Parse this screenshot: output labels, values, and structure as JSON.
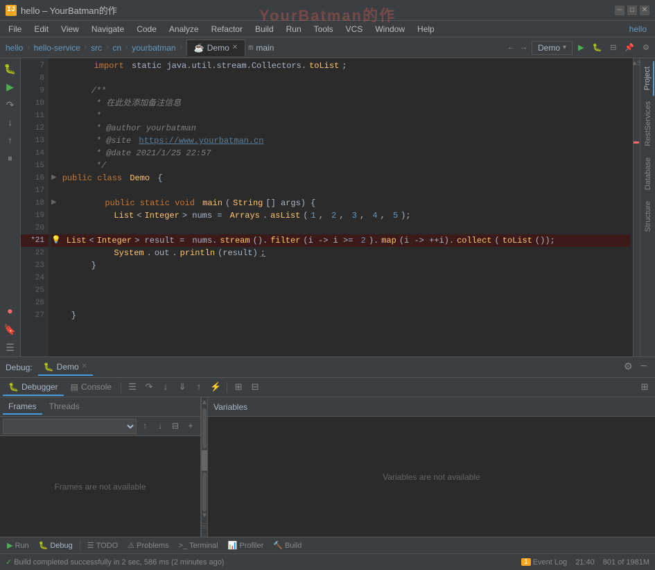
{
  "window": {
    "title": "hello – YourBatman的作",
    "watermark": "YourBatman的作"
  },
  "titlebar": {
    "app_icon": "IJ",
    "title": "hello – YourBatman的作",
    "min_label": "─",
    "max_label": "□",
    "close_label": "✕"
  },
  "menubar": {
    "items": [
      "File",
      "Edit",
      "View",
      "Navigate",
      "Code",
      "Analyze",
      "Refactor",
      "Build",
      "Run",
      "Tools",
      "VCS",
      "Window",
      "Help"
    ]
  },
  "tabbar": {
    "greeting": "hello",
    "breadcrumbs": [
      "hello-service",
      "src",
      "cn",
      "yourbatman"
    ],
    "file_icon": "☕",
    "file_name": "Demo",
    "method_icon": "m",
    "method_name": "main",
    "nav_back": "←",
    "nav_forward": "→",
    "run_config": "Demo",
    "run_config_dropdown": "▾",
    "btn_run": "▶",
    "btn_layout": "⊟",
    "btn_bookmark": "🔖",
    "btn_settings": "⚙"
  },
  "editor": {
    "lines": [
      {
        "num": 7,
        "indent": 1,
        "content": "import static java.util.stream.Collectors.",
        "highlight": "toList",
        "rest": ";"
      },
      {
        "num": 8,
        "indent": 0,
        "content": ""
      },
      {
        "num": 9,
        "indent": 1,
        "content": "/**"
      },
      {
        "num": 10,
        "indent": 1,
        "content": " * 在此处添加备注信息"
      },
      {
        "num": 11,
        "indent": 1,
        "content": " *"
      },
      {
        "num": 12,
        "indent": 1,
        "content": " * @author yourbatman"
      },
      {
        "num": 13,
        "indent": 1,
        "content": " * @site https://www.yourbatman.cn"
      },
      {
        "num": 14,
        "indent": 1,
        "content": " * @date 2021/1/25 22:57"
      },
      {
        "num": 15,
        "indent": 1,
        "content": " */"
      },
      {
        "num": 16,
        "indent": 1,
        "content": "public class Demo {",
        "fold": true
      },
      {
        "num": 17,
        "indent": 0,
        "content": ""
      },
      {
        "num": 18,
        "indent": 2,
        "content": "public static void main(String[] args) {",
        "fold": true
      },
      {
        "num": 19,
        "indent": 3,
        "content": "List<Integer> nums = Arrays.asList(1, 2, 3, 4, 5);"
      },
      {
        "num": 20,
        "indent": 0,
        "content": ""
      },
      {
        "num": 21,
        "indent": 3,
        "content": "List<Integer> result = nums.stream().filter(i -> i >= 2).map(i -> ++i).collect(toList());",
        "error": true,
        "warning": true
      },
      {
        "num": 22,
        "indent": 3,
        "content": "System.out.println(result);"
      },
      {
        "num": 23,
        "indent": 2,
        "content": "}"
      },
      {
        "num": 24,
        "indent": 0,
        "content": ""
      },
      {
        "num": 25,
        "indent": 0,
        "content": ""
      },
      {
        "num": 26,
        "indent": 0,
        "content": ""
      },
      {
        "num": 27,
        "indent": 1,
        "content": "}"
      }
    ],
    "error_count": "▲ 3"
  },
  "right_sidebar": {
    "tabs": [
      "Project",
      "RestServices",
      "Database",
      "Structure"
    ]
  },
  "debug_panel": {
    "debug_label": "Debug:",
    "session_name": "Demo",
    "close_session": "✕",
    "settings_icon": "⚙",
    "minimize_icon": "─",
    "tabs": {
      "debugger_label": "Debugger",
      "console_label": "Console"
    },
    "toolbar_buttons": [
      "☰",
      "↑",
      "↓",
      "↙",
      "↗",
      "⚡",
      "⊞",
      "⊟"
    ],
    "frames_tabs": [
      "Frames",
      "Threads"
    ],
    "dropdown_placeholder": "",
    "frames_empty_text": "Frames are not available",
    "variables_label": "Variables",
    "variables_empty_text": "Variables are not available",
    "filter_icon": "⊟",
    "add_icon": "+"
  },
  "bottom_toolbar": {
    "buttons": [
      {
        "icon": "▶",
        "label": "Run",
        "name": "run-button"
      },
      {
        "icon": "🐛",
        "label": "Debug",
        "label_only": "Debug",
        "name": "debug-button",
        "active": true
      },
      {
        "icon": "≡",
        "label": "TODO",
        "name": "todo-button"
      },
      {
        "icon": "⚠",
        "label": "Problems",
        "name": "problems-button"
      },
      {
        "icon": ">_",
        "label": "Terminal",
        "name": "terminal-button"
      },
      {
        "icon": "📊",
        "label": "Profiler",
        "name": "profiler-button"
      },
      {
        "icon": "🔨",
        "label": "Build",
        "name": "build-button"
      }
    ]
  },
  "status_bar": {
    "build_status": "Build completed successfully in 2 sec, 586 ms (2 minutes ago)",
    "build_icon": "✓",
    "time": "21:40",
    "memory": "801 of 1981M",
    "event_log": "Event Log",
    "event_count": "1"
  }
}
